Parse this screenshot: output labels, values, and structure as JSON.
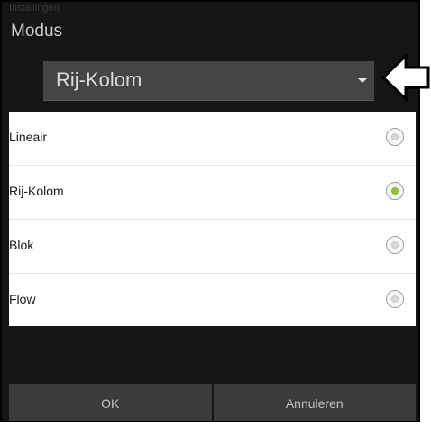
{
  "dialog": {
    "ghost_label": "Instellingen",
    "title": "Modus",
    "spinner": {
      "selected": "Rij-Kolom"
    },
    "options": [
      {
        "label": "Lineair",
        "checked": false
      },
      {
        "label": "Rij-Kolom",
        "checked": true
      },
      {
        "label": "Blok",
        "checked": false
      },
      {
        "label": "Flow",
        "checked": false
      }
    ],
    "buttons": {
      "ok": "OK",
      "cancel": "Annuleren"
    }
  },
  "icons": {
    "spinner_caret": "chevron-down-icon",
    "callout": "arrow-left-icon",
    "radio": "radio-button-icon"
  },
  "colors": {
    "dialog_background": "#151515",
    "radio_selected": "#8ecb2f",
    "list_background": "#ffffff"
  }
}
